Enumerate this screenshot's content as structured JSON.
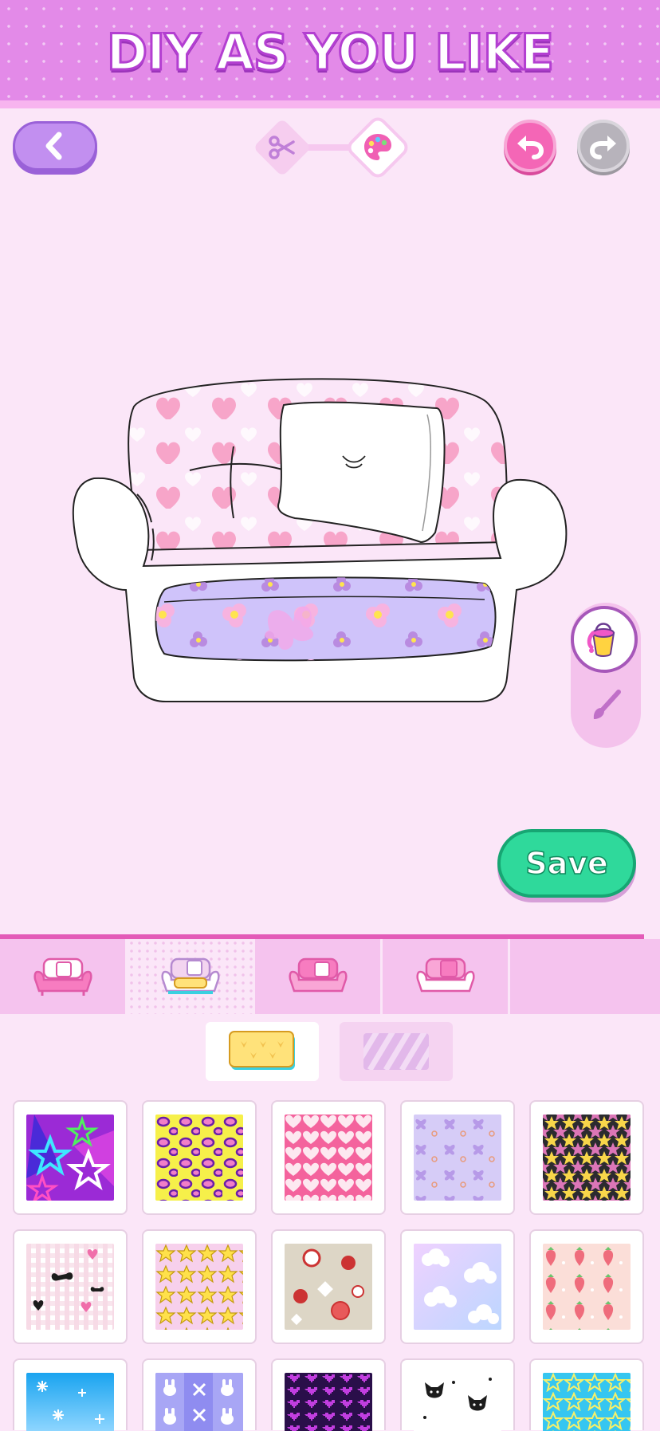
{
  "banner": {
    "title": "DIY AS YOU LIKE"
  },
  "toolbar": {
    "back_icon": "chevron-left-icon",
    "steps": [
      {
        "name": "cut",
        "icon": "scissors-icon",
        "state": "done"
      },
      {
        "name": "paint",
        "icon": "palette-icon",
        "state": "active"
      }
    ],
    "undo_icon": "undo-icon",
    "redo_icon": "redo-icon",
    "redo_enabled": false
  },
  "tools": [
    {
      "icon": "paint-bucket-icon",
      "selected": true
    },
    {
      "icon": "brush-icon",
      "selected": false
    }
  ],
  "save_label": "Save",
  "part_tabs": [
    {
      "icon": "sofa-frame-icon",
      "active": false
    },
    {
      "icon": "sofa-cushion-icon",
      "active": true
    },
    {
      "icon": "sofa-back-icon",
      "active": false
    },
    {
      "icon": "sofa-pillow-icon",
      "active": false
    }
  ],
  "fill_modes": [
    {
      "icon": "pattern-icon",
      "active": true
    },
    {
      "icon": "stripes-icon",
      "active": false
    }
  ],
  "patterns": [
    "purple-stars",
    "yellow-leopard",
    "pink-hearts",
    "lavender-butterflies",
    "black-stars",
    "bows-gingham",
    "yellow-stars-pink",
    "apples-strawberries",
    "blue-clouds",
    "peach-strawberries",
    "blue-snowflakes",
    "purple-bunnies",
    "purple-pixel-hearts",
    "white-cats",
    "teal-stars"
  ],
  "colors": {
    "background": "#fbe6f8",
    "banner": "#e38ae8",
    "accent_pink": "#f466b6",
    "save_green": "#2fd99b",
    "back_purple": "#c28ff0"
  }
}
